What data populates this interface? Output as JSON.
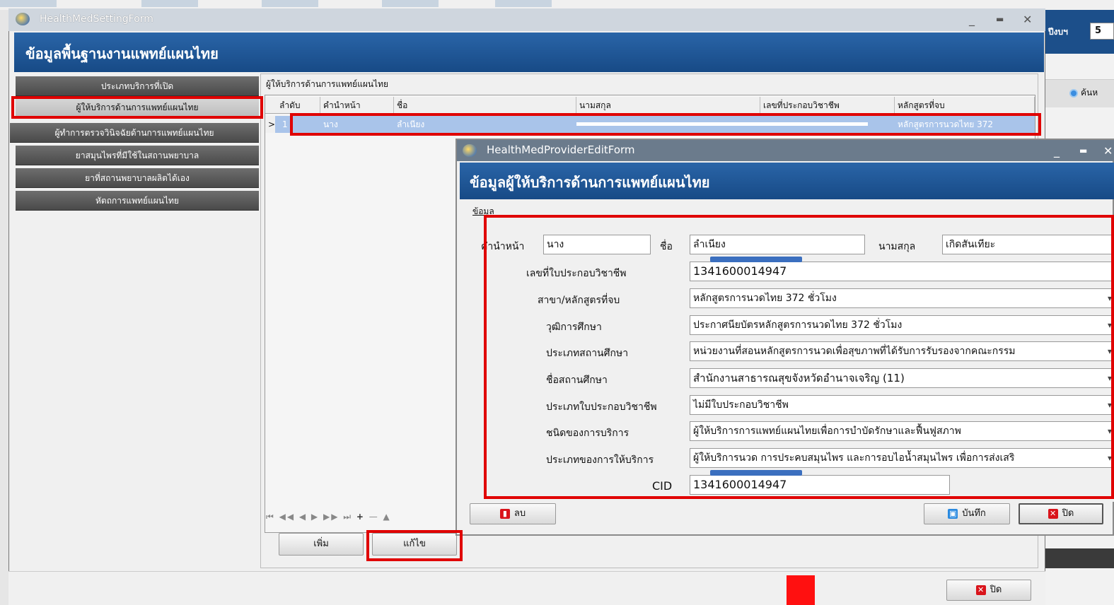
{
  "bg_window": {
    "fiscal_year_label": "ปีงบฯ",
    "fiscal_year_value": "5",
    "search_label": "ค้นห"
  },
  "main_window": {
    "title": "HealthMedSettingForm",
    "header": "ข้อมูลพื้นฐานงานแพทย์แผนไทย",
    "nav": [
      {
        "label": "ประเภทบริการที่เปิด"
      },
      {
        "label": "ผู้ให้บริการด้านการแพทย์แผนไทย"
      },
      {
        "label": "ผู้ทำการตรวจวินิจฉัยด้านการแพทย์แผนไทย"
      },
      {
        "label": "ยาสมุนไพรที่มีใช้ในสถานพยาบาล"
      },
      {
        "label": "ยาที่สถานพยาบาลผลิตได้เอง"
      },
      {
        "label": "หัตถการแพทย์แผนไทย"
      }
    ],
    "grid_title": "ผู้ให้บริการด้านการแพทย์แผนไทย",
    "grid_columns": [
      "ลำดับ",
      "คำนำหน้า",
      "ชื่อ",
      "นามสกุล",
      "เลขที่ประกอบวิชาชีพ",
      "หลักสูตรที่จบ"
    ],
    "grid_row": {
      "num": "1",
      "prefix": "นาง",
      "fname": "ลำเนียง",
      "course": "หลักสูตรการนวดไทย 372"
    },
    "add_label": "เพิ่ม",
    "edit_label": "แก้ไข",
    "close_label": "ปิด"
  },
  "edit_window": {
    "title": "HealthMedProviderEditForm",
    "header": "ข้อมูลผู้ให้บริการด้านการแพทย์แผนไทย",
    "tab": "ข้อมูล",
    "labels": {
      "prefix": "คำนำหน้า",
      "fname": "ชื่อ",
      "lname": "นามสกุล",
      "license_no": "เลขที่ใบประกอบวิชาชีพ",
      "major": "สาขา/หลักสูตรที่จบ",
      "qualification": "วุฒิการศึกษา",
      "inst_type": "ประเภทสถานศึกษา",
      "inst_name": "ชื่อสถานศึกษา",
      "license_type": "ประเภทใบประกอบวิชาชีพ",
      "service_kind": "ชนิดของการบริการ",
      "service_type": "ประเภทของการให้บริการ",
      "cid": "CID"
    },
    "values": {
      "prefix": "นาง",
      "fname": "ลำเนียง",
      "lname": "เกิดสันเทียะ",
      "license_no": "1341600014947",
      "major": "หลักสูตรการนวดไทย 372  ชั่วโมง",
      "qualification": "ประกาศนียบัตรหลักสูตรการนวดไทย 372 ชั่วโมง",
      "inst_type": "หน่วยงานที่สอนหลักสูตรการนวดเพื่อสุขภาพที่ได้รับการรับรองจากคณะกรรม",
      "inst_name": "สำนักงานสาธารณสุขจังหวัดอำนาจเจริญ (11)",
      "license_type": "ไม่มีใบประกอบวิชาชีพ",
      "service_kind": "ผู้ให้บริการการแพทย์แผนไทยเพื่อการบำบัดรักษาและฟื้นฟูสภาพ",
      "service_type": "ผู้ให้บริการนวด การประคบสมุนไพร และการอบไอน้ำสมุนไพร เพื่อการส่งเสริ",
      "cid": "1341600014947"
    },
    "delete_label": "ลบ",
    "save_label": "บันทึก",
    "close_label": "ปิด"
  },
  "colors": {
    "header_blue": "#1f5596",
    "highlight_red": "#e00000",
    "row_selected": "#a9c4ea"
  }
}
